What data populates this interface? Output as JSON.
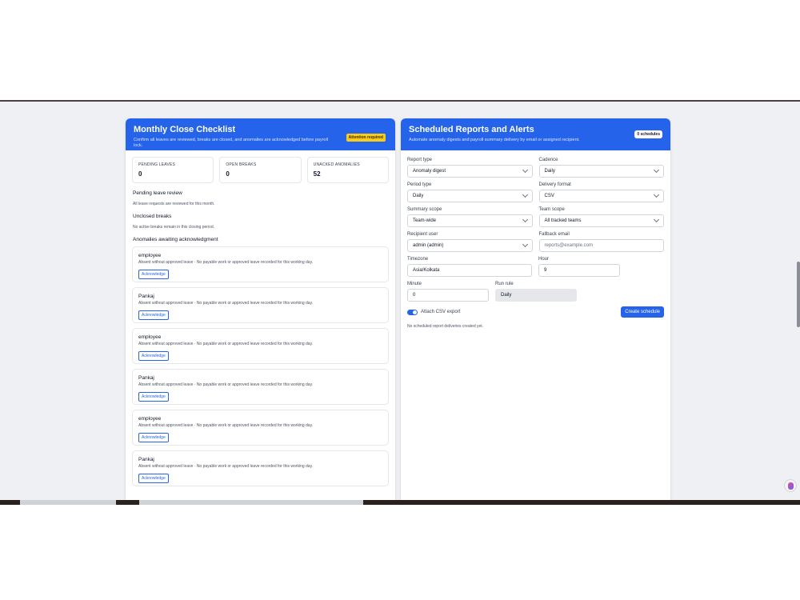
{
  "checklist": {
    "title": "Monthly Close Checklist",
    "subtitle": "Confirm all leaves are reviewed, breaks are closed, and anomalies are acknowledged before payroll lock.",
    "badge": "Attention required",
    "stats": [
      {
        "label": "PENDING LEAVES",
        "value": "0"
      },
      {
        "label": "OPEN BREAKS",
        "value": "0"
      },
      {
        "label": "UNACKED ANOMALIES",
        "value": "52"
      }
    ],
    "pending_leave": {
      "title": "Pending leave review",
      "text": "All leave requests are reviewed for this month."
    },
    "unclosed_breaks": {
      "title": "Unclosed breaks",
      "text": "No active breaks remain in this closing period."
    },
    "anomalies_title": "Anomalies awaiting acknowledgment",
    "ack_label": "Acknowledge",
    "anomalies": [
      {
        "name": "employee",
        "desc": "Absent without approved leave · No payable work or approved leave recorded for this working day."
      },
      {
        "name": "Pankaj",
        "desc": "Absent without approved leave · No payable work or approved leave recorded for this working day."
      },
      {
        "name": "employee",
        "desc": "Absent without approved leave · No payable work or approved leave recorded for this working day."
      },
      {
        "name": "Pankaj",
        "desc": "Absent without approved leave · No payable work or approved leave recorded for this working day."
      },
      {
        "name": "employee",
        "desc": "Absent without approved leave · No payable work or approved leave recorded for this working day."
      },
      {
        "name": "Pankaj",
        "desc": "Absent without approved leave · No payable work or approved leave recorded for this working day."
      }
    ]
  },
  "reports": {
    "title": "Scheduled Reports and Alerts",
    "subtitle": "Automate anomaly digests and payroll summary delivery by email or assigned recipient.",
    "badge": "0 schedules",
    "report_type": {
      "label": "Report type",
      "value": "Anomaly digest"
    },
    "cadence": {
      "label": "Cadence",
      "value": "Daily"
    },
    "period_type": {
      "label": "Period type",
      "value": "Daily"
    },
    "delivery_format": {
      "label": "Delivery format",
      "value": "CSV"
    },
    "summary_scope": {
      "label": "Summary scope",
      "value": "Team-wide"
    },
    "team_scope": {
      "label": "Team scope",
      "value": "All tracked teams"
    },
    "recipient_user": {
      "label": "Recipient user",
      "value": "admin (admin)"
    },
    "fallback_email": {
      "label": "Fallback email",
      "placeholder": "reports@example.com"
    },
    "timezone": {
      "label": "Timezone",
      "value": "Asia/Kolkata"
    },
    "hour": {
      "label": "Hour",
      "value": "9"
    },
    "minute": {
      "label": "Minute",
      "value": "0"
    },
    "run_rule": {
      "label": "Run rule",
      "value": "Daily"
    },
    "attach_csv": {
      "label": "Attach CSV export",
      "on": true
    },
    "create_label": "Create schedule",
    "empty_text": "No scheduled report deliveries created yet."
  },
  "colors": {
    "accent": "#2563eb",
    "warning": "#facc15"
  }
}
